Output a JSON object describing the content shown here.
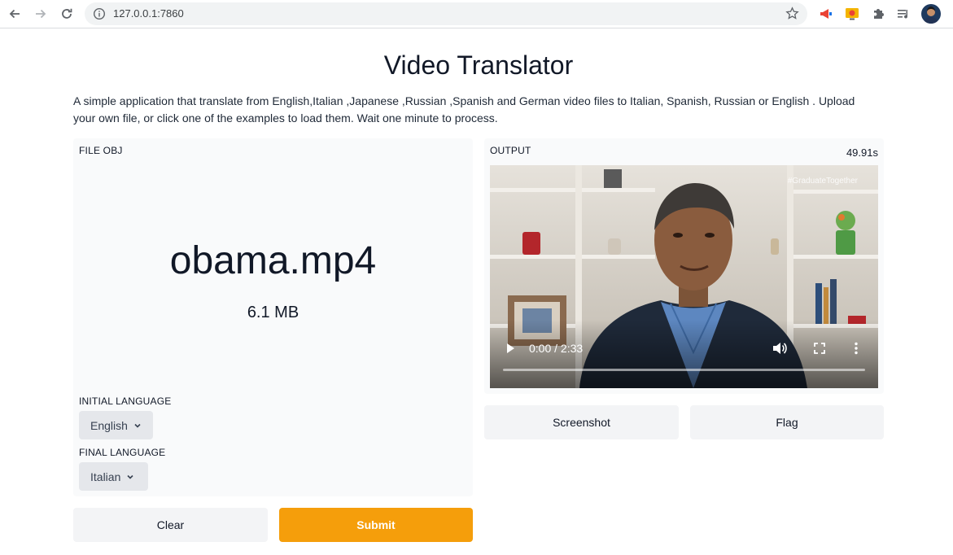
{
  "browser": {
    "url": "127.0.0.1:7860"
  },
  "app": {
    "title": "Video Translator",
    "description": "A simple application that translate from English,Italian ,Japanese ,Russian ,Spanish and German video files to Italian, Spanish, Russian or English . Upload your own file, or click one of the examples to load them. Wait one minute to process."
  },
  "input": {
    "label": "FILE OBJ",
    "file_name": "obama.mp4",
    "file_size": "6.1 MB",
    "initial_language_label": "INITIAL LANGUAGE",
    "initial_language_value": "English",
    "final_language_label": "FINAL LANGUAGE",
    "final_language_value": "Italian"
  },
  "output": {
    "label": "OUTPUT",
    "elapsed": "49.91s",
    "video": {
      "watermark": "#GraduateTogether",
      "time": "0:00 / 2:33",
      "progress": 0.0
    }
  },
  "actions": {
    "clear": "Clear",
    "submit": "Submit",
    "screenshot": "Screenshot",
    "flag": "Flag"
  },
  "colors": {
    "accent": "#f59e0b",
    "panel_bg": "#f9fafb",
    "button_bg": "#f3f4f6",
    "dropdown_bg": "#e5e7eb"
  }
}
